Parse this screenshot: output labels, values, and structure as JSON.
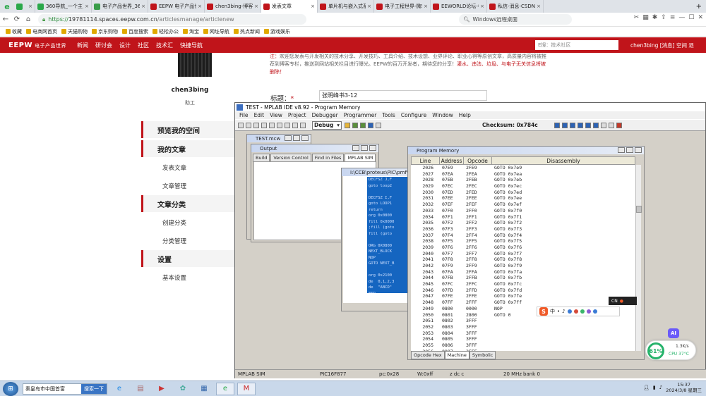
{
  "browser": {
    "tabs": [
      {
        "title": "",
        "color": "#2aa84a"
      },
      {
        "title": "360导航_一个主页",
        "color": "#2aa84a"
      },
      {
        "title": "电子产品世界_360搜",
        "color": "#3a9d4a"
      },
      {
        "title": "EEPW 电子产品世界",
        "color": "#c0141a"
      },
      {
        "title": "chen3bing-博客管理",
        "color": "#c0141a"
      },
      {
        "title": "发表文章",
        "color": "#c0141a"
      },
      {
        "title": "单片机与嵌入式系统",
        "color": "#c0141a"
      },
      {
        "title": "电子工程世界-微软",
        "color": "#c0141a"
      },
      {
        "title": "EEWORLD论坛-中国",
        "color": "#c0141a"
      },
      {
        "title": "私信-消息-CSDN",
        "color": "#c0141a"
      }
    ],
    "active_tab": 5,
    "url_secure": "https://",
    "url_host": "19781114.spaces.eepw.com.cn",
    "url_path": "/articlesmanage/articlenew",
    "search_placeholder": "Windows远程桌面",
    "bookmarks": [
      "收藏",
      "电商网首页",
      "天猫购物",
      "京东购物",
      "百度搜索",
      "轻松办公",
      "淘宝",
      "网址导航",
      "热点新闻",
      "游戏娱乐"
    ]
  },
  "site": {
    "logo": "EEPW",
    "logo_sub": "电子产品世界",
    "nav": [
      "新闻",
      "研讨会",
      "设计",
      "社区",
      "技术汇",
      "快捷导航"
    ],
    "search_placeholder": "E搜：技术社区",
    "user_line": "chen3bing [消息] 空间 退"
  },
  "profile": {
    "username": "chen3bing",
    "rank": "助工"
  },
  "menu": {
    "overview": "预览我的空间",
    "my_articles": "我的文章",
    "publish": "发表文章",
    "manage": "文章管理",
    "categories": "文章分类",
    "create_cat": "创建分类",
    "manage_cat": "分类管理",
    "settings": "设置",
    "basic": "基本设置"
  },
  "form": {
    "notice_prefix": "注：",
    "notice_body": "欢迎您发表与开发相关的技术分享、开发技巧、工具介绍、技术设想、业界评论、职业心得等原创文章，高质量内容将被推荐到博客专栏，推送到网站相关栏目进行曝光。EEPW的百万开发者，期待您的分享！",
    "notice_warn": "灌水、违法、垃圾、与电子无关信息将被删除！",
    "title_label": "标题：",
    "title_star": "*",
    "title_value": "张明峰书3-12"
  },
  "mplab": {
    "title": "TEST - MPLAB IDE v8.92 - Program Memory",
    "menu": [
      "File",
      "Edit",
      "View",
      "Project",
      "Debugger",
      "Programmer",
      "Tools",
      "Configure",
      "Window",
      "Help"
    ],
    "config": "Debug",
    "checksum": "Checksum:  0x784c",
    "status": {
      "tool": "MPLAB SIM",
      "device": "PIC16F877",
      "pc": "pc:0x28",
      "w": "W:0xff",
      "flags": "z dc c",
      "freq": "20 MHz",
      "bank": "bank 0"
    },
    "workspace_title": "TEST.mcw",
    "output_title": "Output",
    "output_tabs": [
      "Build",
      "Version Control",
      "Find in Files",
      "MPLAB SIM"
    ],
    "source_title": "I:\\CCB\\proteus\\PIC\\pmf\\",
    "source_code": "DECFSZ J,F\ngoto loop2\n\nDECFSZ I,F\ngoto LOOP1\nreturn\norg 0x0800\nfill 0x0000\n;fill (goto\nfill (goto\n\nORG 0X0800\nNEXT_BLOCK\nNOP\nGOTO NEXT_B\n\norg 0x2100\nde  0,1,2,3\nde  \"ABCD\"\nEND"
  },
  "program_memory": {
    "title": "Program Memory",
    "headers": [
      "Line",
      "Address",
      "Opcode",
      "Disassembly"
    ],
    "tabs": [
      "Opcode Hex",
      "Machine",
      "Symbolic"
    ],
    "active_tab": 1,
    "rows": [
      [
        "2026",
        "07E9",
        "2FE9",
        "GOTO 0x7e9"
      ],
      [
        "2027",
        "07EA",
        "2FEA",
        "GOTO 0x7ea"
      ],
      [
        "2028",
        "07EB",
        "2FEB",
        "GOTO 0x7eb"
      ],
      [
        "2029",
        "07EC",
        "2FEC",
        "GOTO 0x7ec"
      ],
      [
        "2030",
        "07ED",
        "2FED",
        "GOTO 0x7ed"
      ],
      [
        "2031",
        "07EE",
        "2FEE",
        "GOTO 0x7ee"
      ],
      [
        "2032",
        "07EF",
        "2FEF",
        "GOTO 0x7ef"
      ],
      [
        "2033",
        "07F0",
        "2FF0",
        "GOTO 0x7f0"
      ],
      [
        "2034",
        "07F1",
        "2FF1",
        "GOTO 0x7f1"
      ],
      [
        "2035",
        "07F2",
        "2FF2",
        "GOTO 0x7f2"
      ],
      [
        "2036",
        "07F3",
        "2FF3",
        "GOTO 0x7f3"
      ],
      [
        "2037",
        "07F4",
        "2FF4",
        "GOTO 0x7f4"
      ],
      [
        "2038",
        "07F5",
        "2FF5",
        "GOTO 0x7f5"
      ],
      [
        "2039",
        "07F6",
        "2FF6",
        "GOTO 0x7f6"
      ],
      [
        "2040",
        "07F7",
        "2FF7",
        "GOTO 0x7f7"
      ],
      [
        "2041",
        "07F8",
        "2FF8",
        "GOTO 0x7f8"
      ],
      [
        "2042",
        "07F9",
        "2FF9",
        "GOTO 0x7f9"
      ],
      [
        "2043",
        "07FA",
        "2FFA",
        "GOTO 0x7fa"
      ],
      [
        "2044",
        "07FB",
        "2FFB",
        "GOTO 0x7fb"
      ],
      [
        "2045",
        "07FC",
        "2FFC",
        "GOTO 0x7fc"
      ],
      [
        "2046",
        "07FD",
        "2FFD",
        "GOTO 0x7fd"
      ],
      [
        "2047",
        "07FE",
        "2FFE",
        "GOTO 0x7fe"
      ],
      [
        "2048",
        "07FF",
        "2FFF",
        "GOTO 0x7ff"
      ],
      [
        "2049",
        "0800",
        "0000",
        "NOP"
      ],
      [
        "2050",
        "0801",
        "2800",
        "GOTO 0"
      ],
      [
        "2051",
        "0802",
        "3FFF",
        ""
      ],
      [
        "2052",
        "0803",
        "3FFF",
        ""
      ],
      [
        "2053",
        "0804",
        "3FFF",
        ""
      ],
      [
        "2054",
        "0805",
        "3FFF",
        ""
      ],
      [
        "2055",
        "0806",
        "3FFF",
        ""
      ],
      [
        "2056",
        "0807",
        "3FFF",
        ""
      ],
      [
        "2057",
        "0808",
        "3FFF",
        ""
      ]
    ]
  },
  "ime": {
    "small": "CN",
    "badge": "S",
    "items": [
      "中",
      "•",
      "♪"
    ]
  },
  "widget": {
    "ai": "AI",
    "cpu": "61%",
    "net": "1.3K/s",
    "temp": "CPU 37°C"
  },
  "taskbar": {
    "search_text": "秦皇岛市中国首富",
    "search_btn": "搜索一下",
    "time": "15:37",
    "date": "2024/3/8 星期三"
  }
}
